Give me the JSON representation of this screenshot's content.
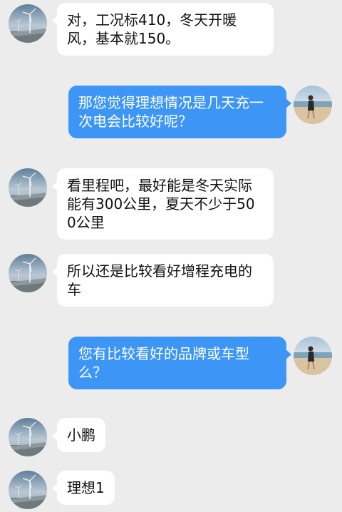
{
  "colors": {
    "background": "#ececec",
    "incoming_bubble": "#ffffff",
    "outgoing_bubble": "#3d95f5",
    "incoming_text": "#111111",
    "outgoing_text": "#ffffff"
  },
  "icons": {
    "contact_avatar": "wind-turbine-avatar-icon",
    "user_avatar": "beach-walker-avatar-icon"
  },
  "messages": [
    {
      "side": "left",
      "text": "对，工况标410，冬天开暖风，基本就150。"
    },
    {
      "side": "right",
      "text": "那您觉得理想情况是几天充一次电会比较好呢？"
    },
    {
      "side": "left",
      "text": "看里程吧，最好能是冬天实际能有300公里，夏天不少于500公里"
    },
    {
      "side": "left",
      "text": "所以还是比较看好增程充电的车"
    },
    {
      "side": "right",
      "text": "您有比较看好的品牌或车型么？"
    },
    {
      "side": "left",
      "text": "小鹏"
    },
    {
      "side": "left",
      "text": "理想1"
    }
  ]
}
